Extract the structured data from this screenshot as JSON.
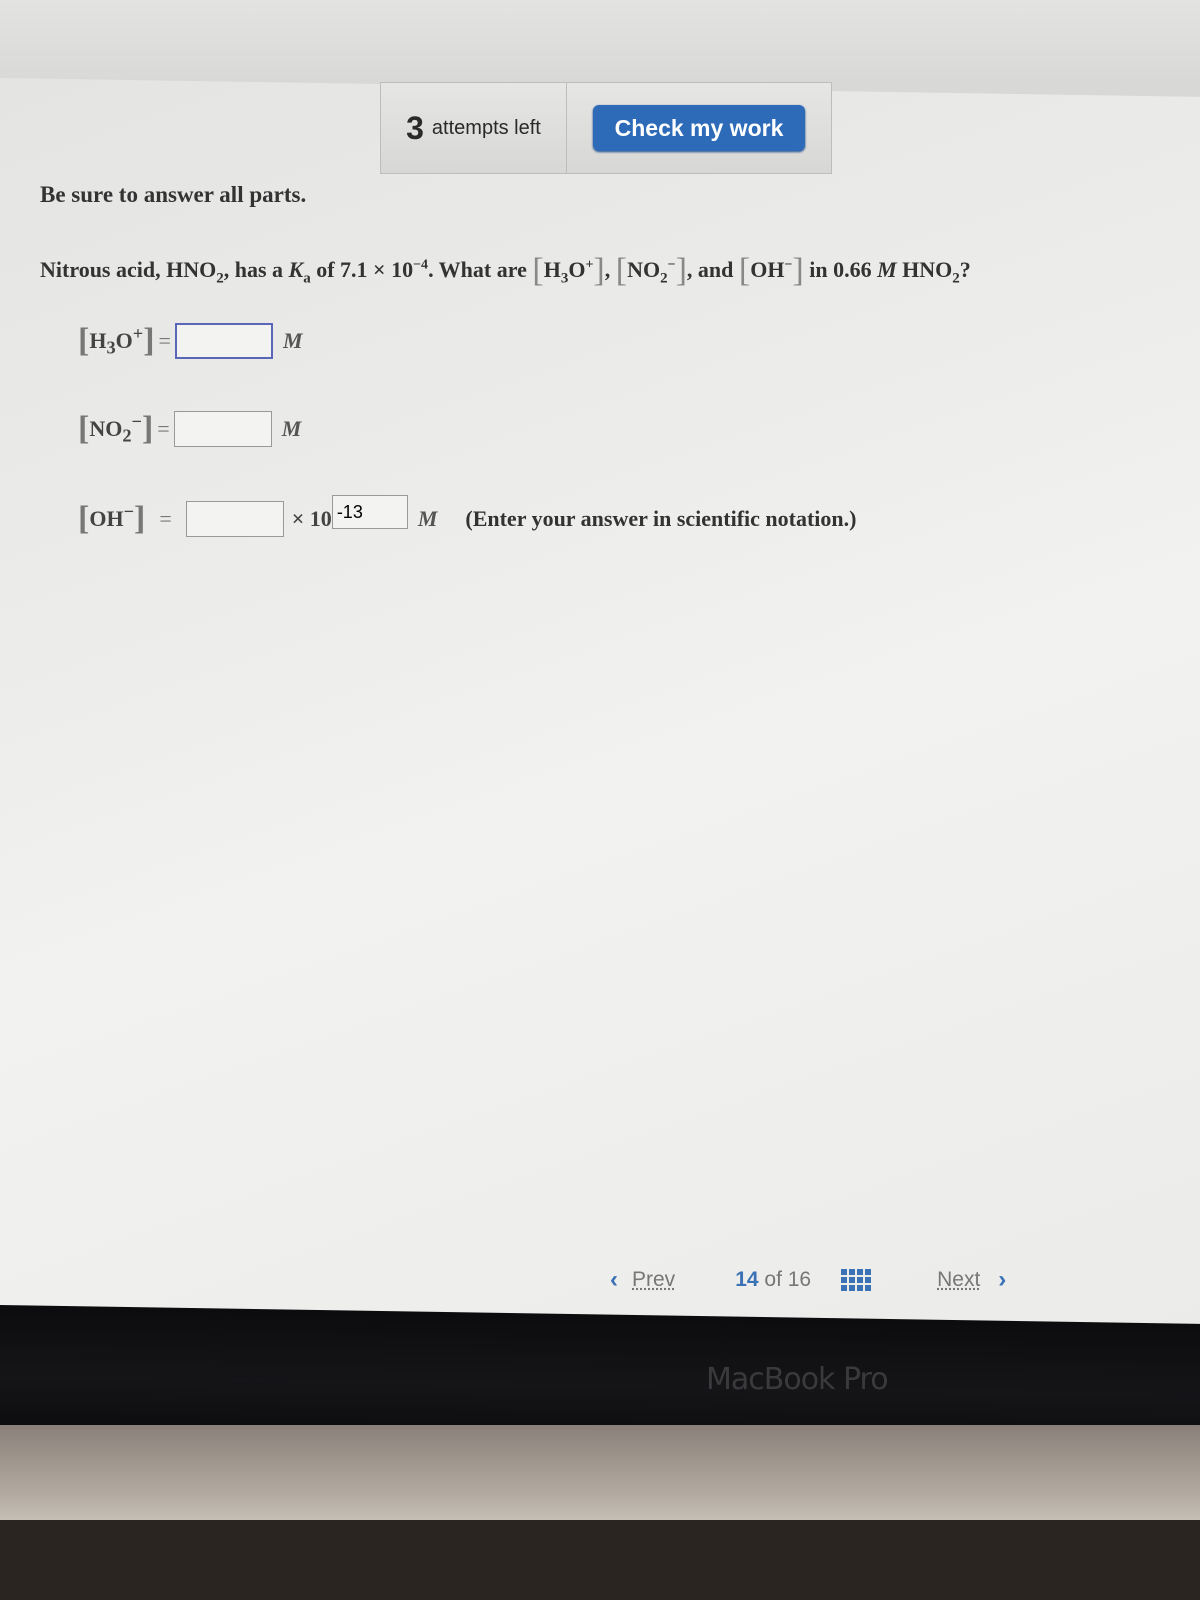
{
  "toolbar": {
    "attempts_count": "3",
    "attempts_label": "attempts left",
    "check_button": "Check my work"
  },
  "instructions": "Be sure to answer all parts.",
  "question": {
    "intro": "Nitrous acid, HNO",
    "sub2": "2",
    "mid1": ", has a ",
    "ka": "K",
    "ka_sub": "a",
    "mid2": " of 7.1 × 10",
    "exp": "−4",
    "mid3": ". What are ",
    "h3o": "H",
    "h3o_sub": "3",
    "h3o_o": "O",
    "h3o_sup": "+",
    "no2": "NO",
    "no2_sub": "2",
    "no2_sup": "−",
    "and": ", and ",
    "oh": "OH",
    "oh_sup": "−",
    "tail": " in 0.66 ",
    "molar": "M",
    "hno2": " HNO",
    "hno2_sub": "2",
    "q": "?"
  },
  "answers": [
    {
      "label_main": "H",
      "label_sub": "3",
      "label_o": "O",
      "label_sup": "+",
      "value": "",
      "unit": "M"
    },
    {
      "label_main": "NO",
      "label_sub": "2",
      "label_sup": "−",
      "value": "",
      "unit": "M"
    },
    {
      "label_main": "OH",
      "label_sup": "−",
      "value": "",
      "times": "× 10",
      "exponent": "-13",
      "unit": "M",
      "hint": "(Enter your answer in scientific notation.)"
    }
  ],
  "equals": "=",
  "nav": {
    "prev": "Prev",
    "current": "14",
    "of": "of",
    "total": "16",
    "next": "Next",
    "prev_icon": "‹",
    "next_icon": "›"
  },
  "device_label": "MacBook Pro"
}
